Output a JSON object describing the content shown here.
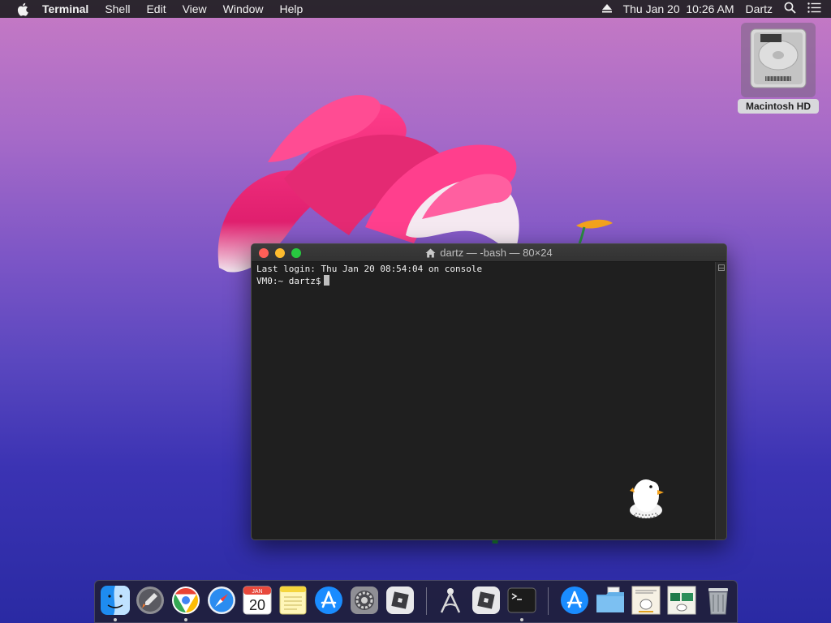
{
  "menubar": {
    "app_name": "Terminal",
    "menus": [
      "Shell",
      "Edit",
      "View",
      "Window",
      "Help"
    ],
    "clock": "Thu Jan 20  10:26 AM",
    "user": "Dartz",
    "icons": [
      "apple-icon",
      "eject-icon",
      "spotlight-search-icon",
      "notification-center-icon"
    ]
  },
  "desktop": {
    "disk_label": "Macintosh HD"
  },
  "terminal": {
    "title": "dartz — -bash — 80×24",
    "lines": [
      "Last login: Thu Jan 20 08:54:04 on console",
      "VM0:~ dartz$"
    ]
  },
  "dock": {
    "calendar": {
      "month": "JAN",
      "day": "20"
    },
    "items": [
      "finder-icon",
      "launchpad-icon",
      "chrome-icon",
      "safari-icon",
      "calendar-icon",
      "notes-icon",
      "app-store-icon",
      "system-preferences-icon",
      "roblox-icon",
      "instruments-icon",
      "roblox-studio-icon",
      "terminal-icon",
      "app-store-downloads-icon",
      "documents-folder-icon",
      "image-thumbnail-icon",
      "image-thumbnail-icon",
      "trash-icon"
    ]
  },
  "colors": {
    "menubar_bg": "#1e1e22",
    "terminal_bg": "#1f1f1f",
    "close": "#ff5f57",
    "minimize": "#febc2e",
    "maximize": "#28c840"
  }
}
